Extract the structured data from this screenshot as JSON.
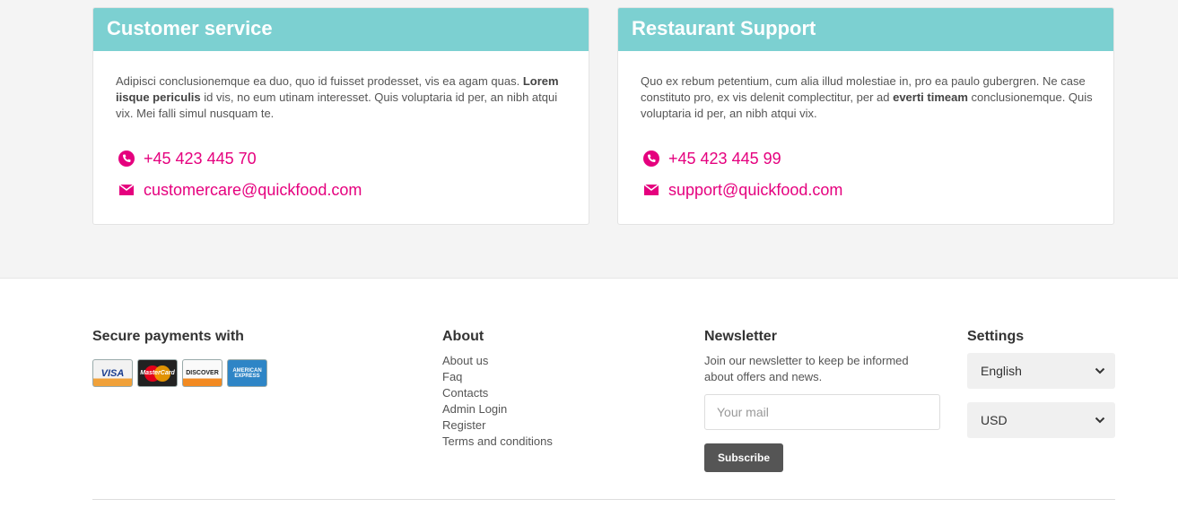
{
  "support": [
    {
      "title": "Customer service",
      "text_before": "Adipisci conclusionemque ea duo, quo id fuisset prodesset, vis ea agam quas. ",
      "text_bold": "Lorem iisque periculis",
      "text_after": " id vis, no eum utinam interesset. Quis voluptaria id per, an nibh atqui vix. Mei falli simul nusquam te.",
      "phone": "+45 423 445 70",
      "email": "customercare@quickfood.com"
    },
    {
      "title": "Restaurant Support",
      "text_before": "Quo ex rebum petentium, cum alia illud molestiae in, pro ea paulo gubergren. Ne case constituto pro, ex vis delenit complectitur, per ad ",
      "text_bold": "everti timeam",
      "text_after": " conclusionemque. Quis voluptaria id per, an nibh atqui vix.",
      "phone": "+45 423 445 99",
      "email": "support@quickfood.com"
    }
  ],
  "footer": {
    "payments": {
      "title": "Secure payments with",
      "cards": [
        {
          "name": "visa",
          "label": "VISA"
        },
        {
          "name": "mastercard",
          "label": "MasterCard"
        },
        {
          "name": "discover",
          "label": "DISCOVER"
        },
        {
          "name": "amex",
          "label": "AMERICAN EXPRESS"
        }
      ]
    },
    "about": {
      "title": "About",
      "links": [
        "About us",
        "Faq",
        "Contacts",
        "Admin Login",
        "Register",
        "Terms and conditions"
      ]
    },
    "newsletter": {
      "title": "Newsletter",
      "text": "Join our newsletter to keep be informed about offers and news.",
      "placeholder": "Your mail",
      "button": "Subscribe"
    },
    "settings": {
      "title": "Settings",
      "language": "English",
      "currency": "USD"
    }
  },
  "colors": {
    "accent": "#e5007e",
    "header_bg": "#7cd0d1"
  }
}
